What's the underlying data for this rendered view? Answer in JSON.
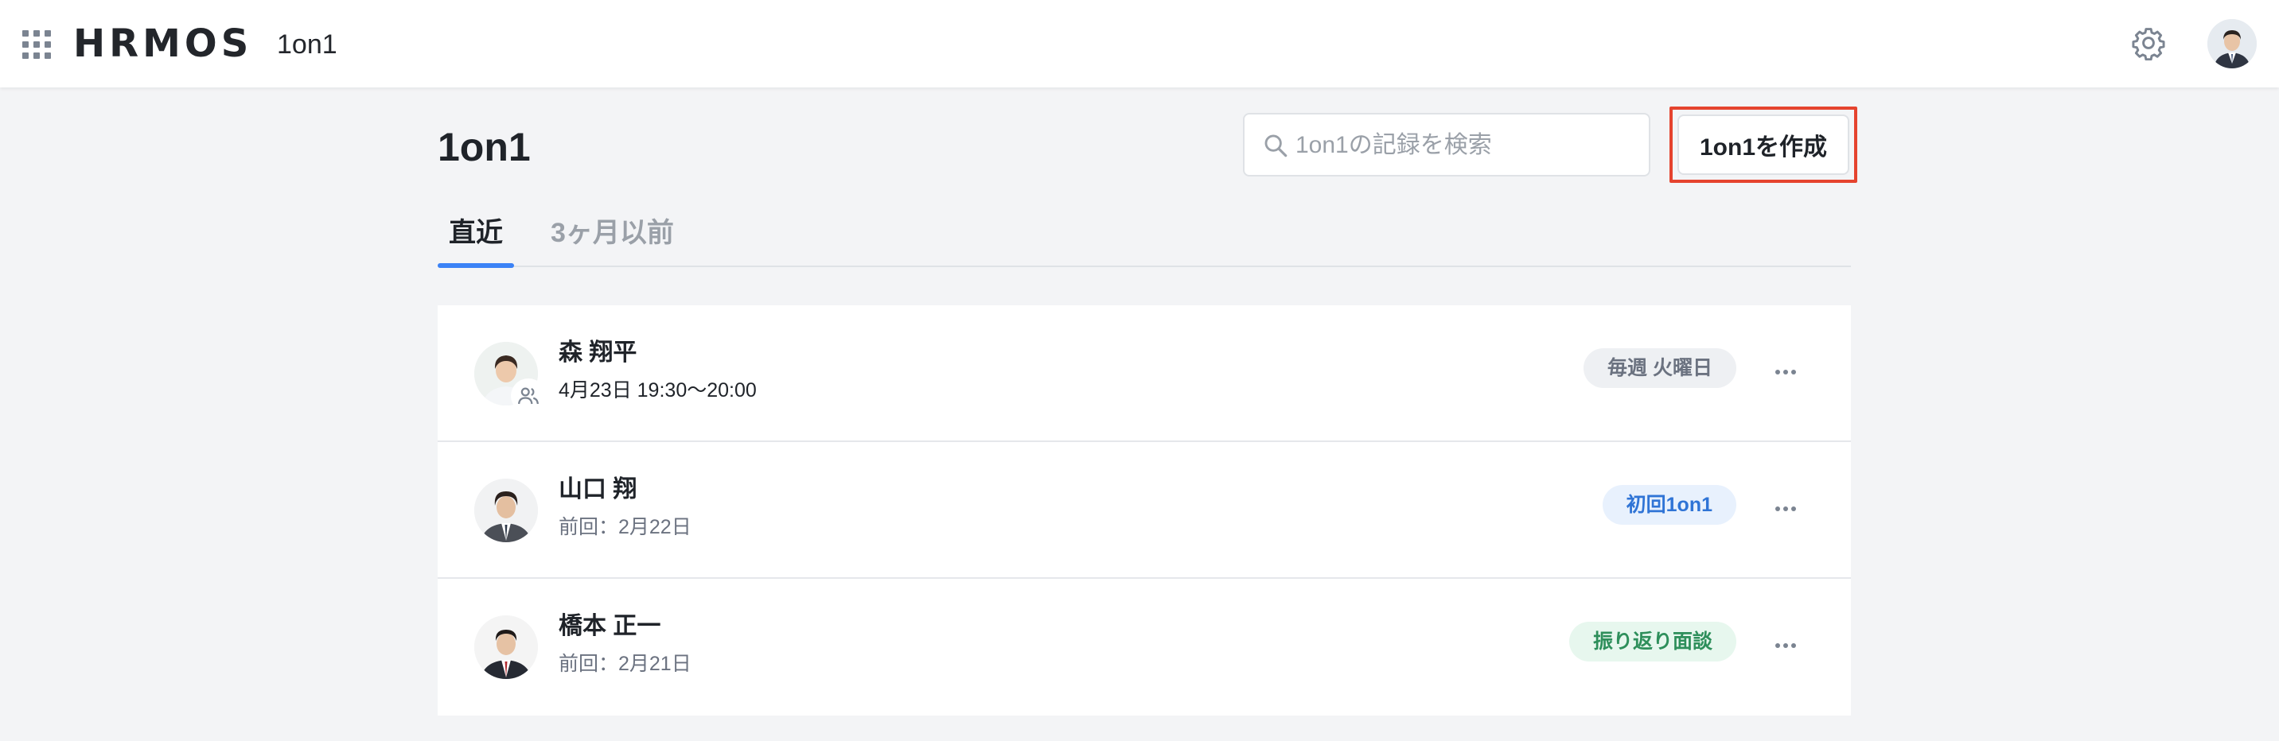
{
  "header": {
    "logo": "HRMOS",
    "product": "1on1"
  },
  "page": {
    "title": "1on1",
    "search_placeholder": "1on1の記録を検索",
    "create_button": "1on1を作成"
  },
  "tabs": [
    {
      "label": "直近",
      "active": true
    },
    {
      "label": "3ヶ月以前",
      "active": false
    }
  ],
  "rows": [
    {
      "name": "森 翔平",
      "subtitle": "4月23日 19:30〜20:00",
      "tag": "毎週 火曜日",
      "tag_color": "gray",
      "has_group_badge": true
    },
    {
      "name": "山口 翔",
      "subtitle": "前回：2月22日",
      "tag": "初回1on1",
      "tag_color": "blue",
      "has_group_badge": false
    },
    {
      "name": "橋本 正一",
      "subtitle": "前回：2月21日",
      "tag": "振り返り面談",
      "tag_color": "green",
      "has_group_badge": false
    }
  ],
  "colors": {
    "accent": "#3b82f6",
    "highlight_border": "#e5432e",
    "background": "#f3f4f6"
  }
}
